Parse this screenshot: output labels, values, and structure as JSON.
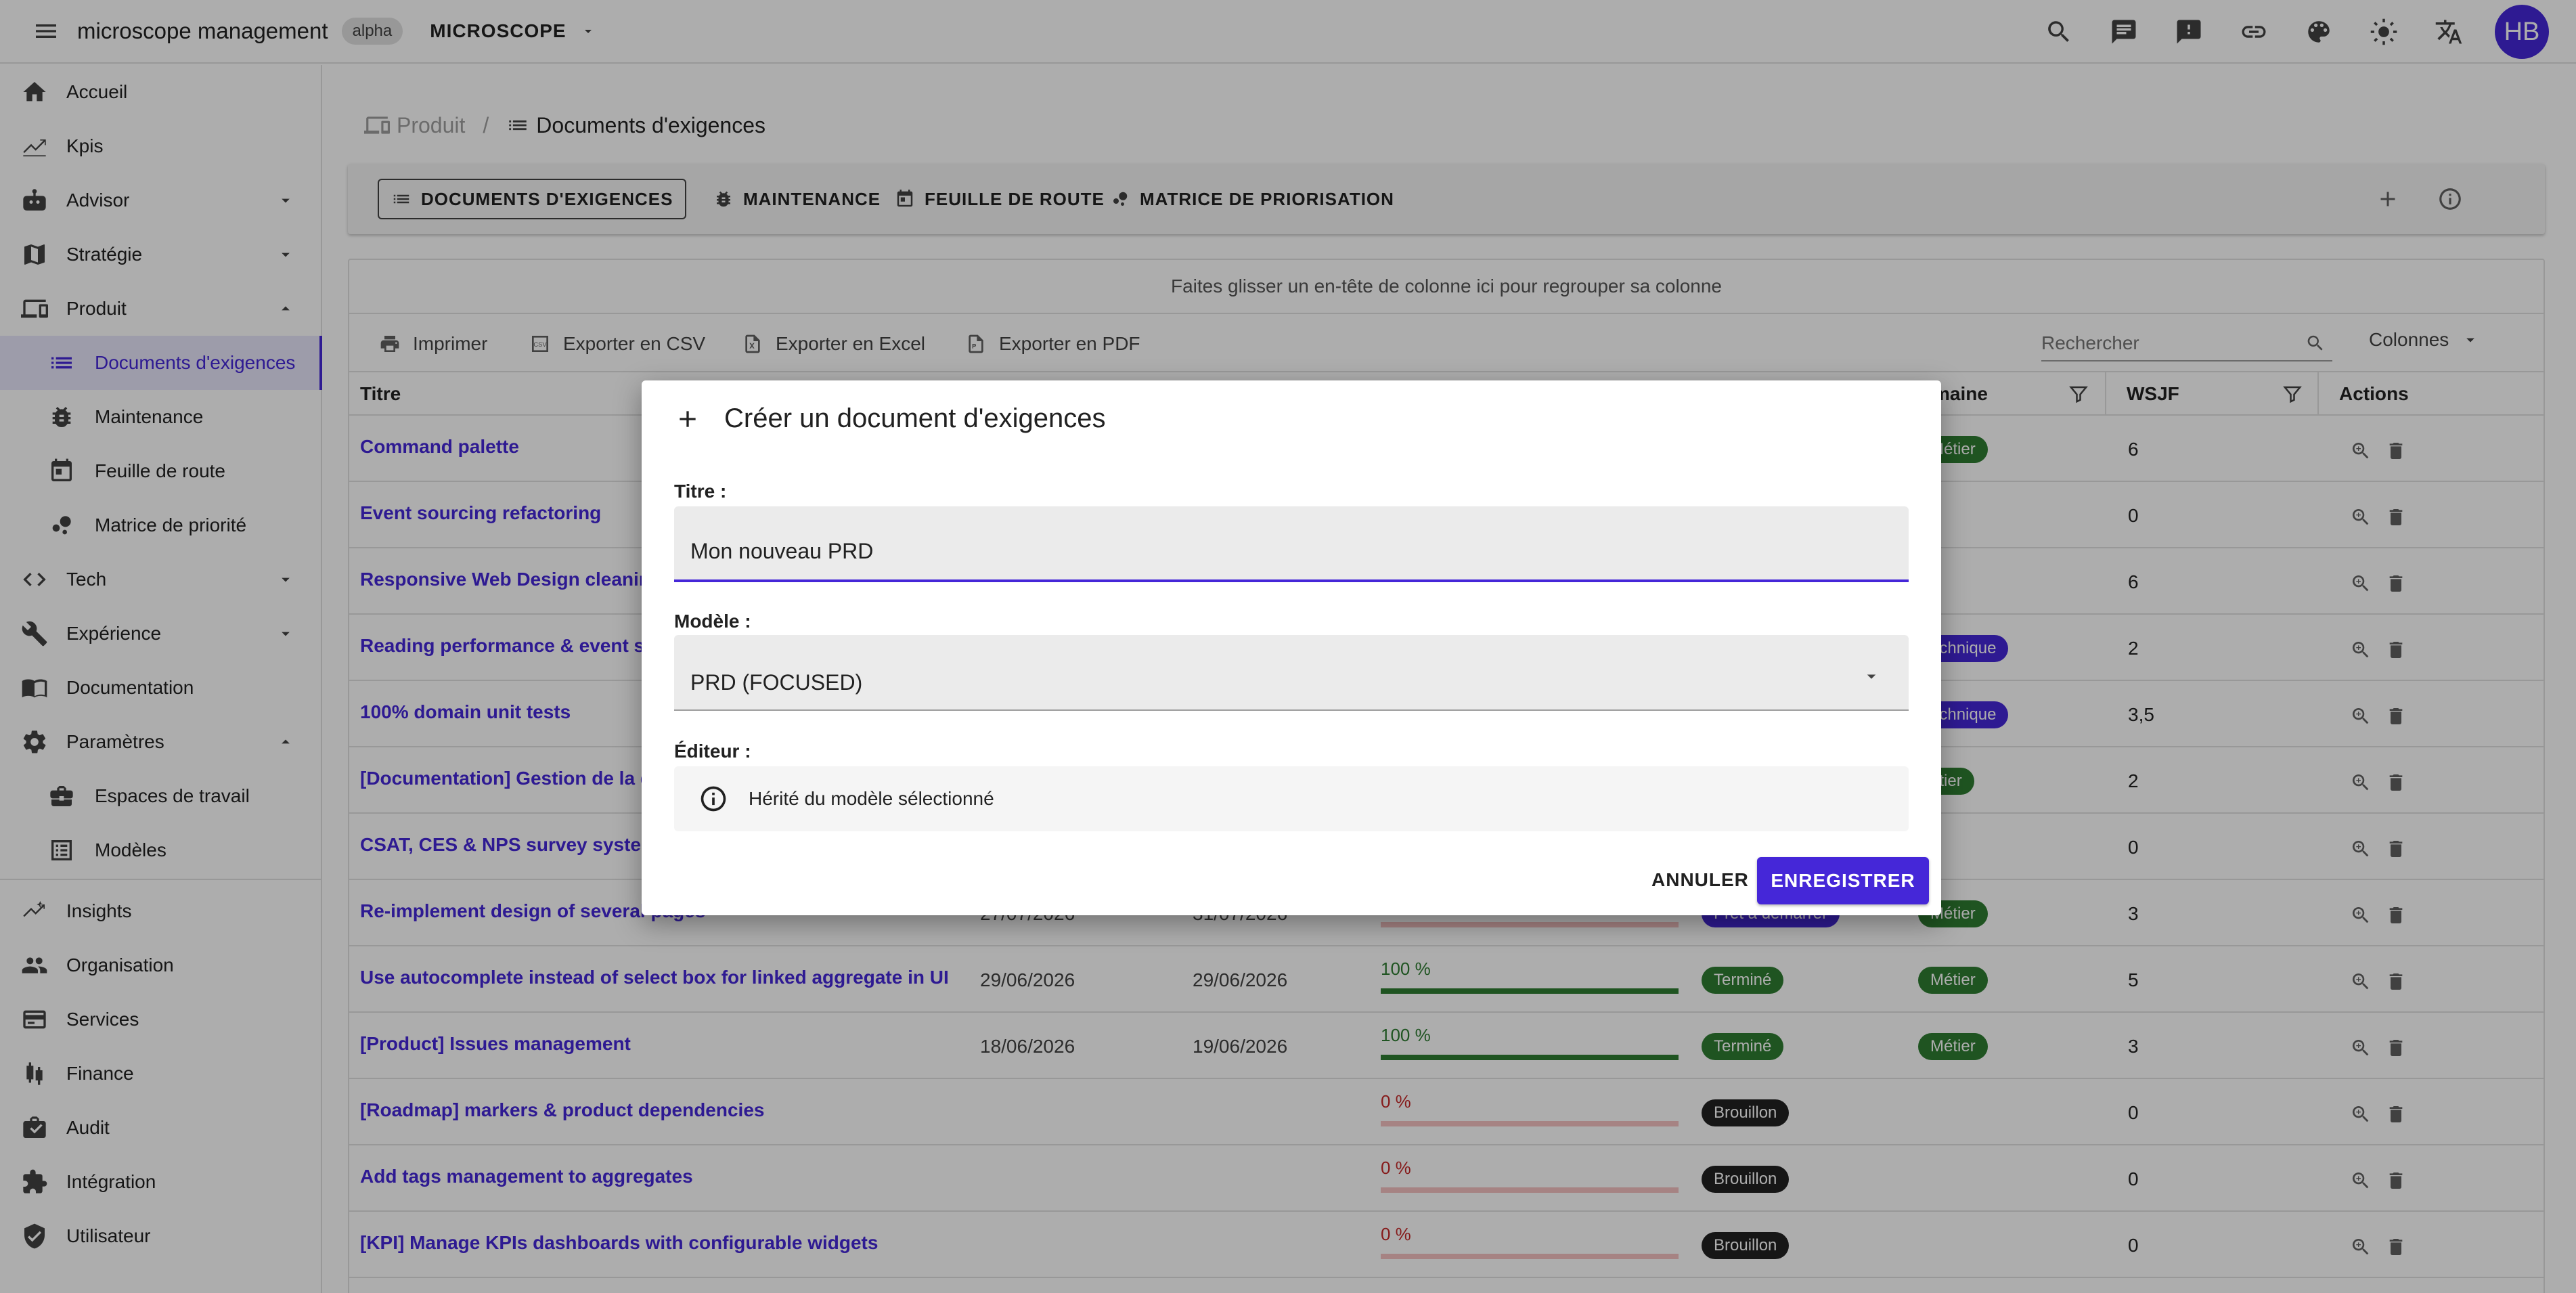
{
  "app": {
    "title": "microscope management",
    "badge": "alpha",
    "workspace": "MICROSCOPE",
    "avatar_initials": "HB",
    "accent_color": "#4527d8",
    "top_icons": [
      "search-icon",
      "chat-icon",
      "feedback-icon",
      "link-icon",
      "palette-icon",
      "brightness-icon",
      "translate-icon"
    ]
  },
  "sidebar": {
    "items": [
      {
        "label": "Accueil",
        "icon": "home-icon"
      },
      {
        "label": "Kpis",
        "icon": "chart-icon"
      },
      {
        "label": "Advisor",
        "icon": "robot-icon"
      },
      {
        "label": "Stratégie",
        "icon": "map-icon"
      },
      {
        "label": "Produit",
        "icon": "devices-icon"
      },
      {
        "label": "Documents d'exigences",
        "icon": "list-icon"
      },
      {
        "label": "Maintenance",
        "icon": "bug-icon"
      },
      {
        "label": "Feuille de route",
        "icon": "calendar-icon"
      },
      {
        "label": "Matrice de priorité",
        "icon": "bubble-chart-icon"
      },
      {
        "label": "Tech",
        "icon": "code-icon"
      },
      {
        "label": "Expérience",
        "icon": "tools-icon"
      },
      {
        "label": "Documentation",
        "icon": "book-icon"
      },
      {
        "label": "Paramètres",
        "icon": "gear-icon"
      },
      {
        "label": "Espaces de travail",
        "icon": "briefcase-icon"
      },
      {
        "label": "Modèles",
        "icon": "template-icon"
      },
      {
        "label": "Insights",
        "icon": "insights-icon"
      },
      {
        "label": "Organisation",
        "icon": "people-icon"
      },
      {
        "label": "Services",
        "icon": "services-icon"
      },
      {
        "label": "Finance",
        "icon": "finance-icon"
      },
      {
        "label": "Audit",
        "icon": "audit-icon"
      },
      {
        "label": "Intégration",
        "icon": "integration-icon"
      },
      {
        "label": "Utilisateur",
        "icon": "shield-icon"
      }
    ]
  },
  "breadcrumb": {
    "parent": "Produit",
    "current": "Documents d'exigences"
  },
  "tabs": [
    {
      "label": "DOCUMENTS D'EXIGENCES",
      "selected": true
    },
    {
      "label": "MAINTENANCE"
    },
    {
      "label": "FEUILLE DE ROUTE"
    },
    {
      "label": "MATRICE DE PRIORISATION"
    }
  ],
  "grid": {
    "group_hint": "Faites glisser un en-tête de colonne ici pour regrouper sa colonne",
    "toolbar": {
      "print": "Imprimer",
      "csv": "Exporter en CSV",
      "excel": "Exporter en Excel",
      "pdf": "Exporter en PDF",
      "search_placeholder": "Rechercher",
      "columns": "Colonnes"
    },
    "headers": {
      "title": "Titre",
      "domain": "maine",
      "wsjf": "WSJF",
      "actions": "Actions"
    },
    "rows": [
      {
        "title": "Command palette",
        "start": "",
        "end": "",
        "progress": "",
        "status": "",
        "domain": "Métier",
        "wsjf": "6"
      },
      {
        "title": "Event sourcing refactoring",
        "start": "",
        "end": "",
        "progress": "",
        "status": "",
        "domain": "",
        "wsjf": "0"
      },
      {
        "title": "Responsive Web Design cleaning",
        "start": "",
        "end": "",
        "progress": "",
        "status": "",
        "domain": "",
        "wsjf": "6"
      },
      {
        "title": "Reading performance & event sc",
        "start": "",
        "end": "",
        "progress": "",
        "status": "",
        "domain": "echnique",
        "wsjf": "2"
      },
      {
        "title": "100% domain unit tests",
        "start": "",
        "end": "",
        "progress": "",
        "status": "",
        "domain": "echnique",
        "wsjf": "3,5"
      },
      {
        "title": "[Documentation] Gestion de la d",
        "start": "",
        "end": "",
        "progress": "",
        "status": "",
        "domain": "étier",
        "wsjf": "2"
      },
      {
        "title": "CSAT, CES & NPS survey system",
        "start": "",
        "end": "",
        "progress": "",
        "status": "",
        "domain": "",
        "wsjf": "0"
      },
      {
        "title": "Re-implement design of several pages",
        "start": "27/07/2026",
        "end": "31/07/2026",
        "progress": "0 %",
        "progress_value": 0,
        "status": "Prêt à démarrer",
        "domain": "Métier",
        "wsjf": "3"
      },
      {
        "title": "Use autocomplete instead of select box for linked aggregate in UI",
        "start": "29/06/2026",
        "end": "29/06/2026",
        "progress": "100 %",
        "progress_value": 100,
        "status": "Terminé",
        "domain": "Métier",
        "wsjf": "5"
      },
      {
        "title": "[Product] Issues management",
        "start": "18/06/2026",
        "end": "19/06/2026",
        "progress": "100 %",
        "progress_value": 100,
        "status": "Terminé",
        "domain": "Métier",
        "wsjf": "3"
      },
      {
        "title": "[Roadmap] markers & product dependencies",
        "start": "",
        "end": "",
        "progress": "0 %",
        "progress_value": 0,
        "status": "Brouillon",
        "domain": "",
        "wsjf": "0"
      },
      {
        "title": "Add tags management to aggregates",
        "start": "",
        "end": "",
        "progress": "0 %",
        "progress_value": 0,
        "status": "Brouillon",
        "domain": "",
        "wsjf": "0"
      },
      {
        "title": "[KPI] Manage KPIs dashboards with configurable widgets",
        "start": "",
        "end": "",
        "progress": "0 %",
        "progress_value": 0,
        "status": "Brouillon",
        "domain": "",
        "wsjf": "0"
      }
    ]
  },
  "dialog": {
    "title": "Créer un document d'exigences",
    "title_label": "Titre :",
    "title_value": "Mon nouveau PRD",
    "model_label": "Modèle :",
    "model_value": "PRD (FOCUSED)",
    "editor_label": "Éditeur :",
    "editor_info": "Hérité du modèle sélectionné",
    "cancel": "ANNULER",
    "save": "ENREGISTRER"
  }
}
